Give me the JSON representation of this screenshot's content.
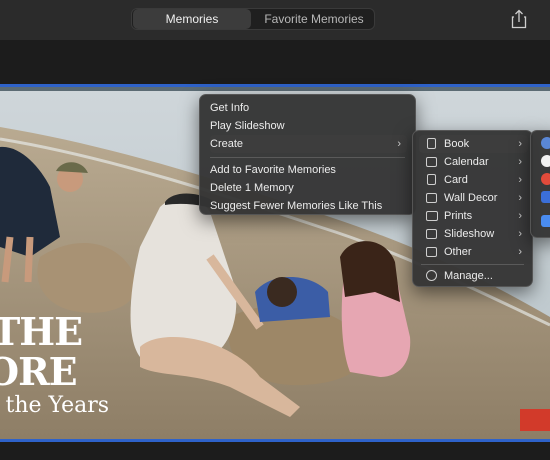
{
  "toolbar": {
    "tabs": [
      {
        "label": "Memories",
        "active": true
      },
      {
        "label": "Favorite Memories",
        "active": false
      }
    ],
    "share_icon": "share-icon"
  },
  "photo": {
    "title_lines": [
      "THE",
      "ORE",
      "r the Years"
    ]
  },
  "context_menu": {
    "items": [
      {
        "label": "Get Info"
      },
      {
        "label": "Play Slideshow"
      },
      {
        "label": "Create",
        "submenu": true
      },
      {
        "label": "Add to Favorite Memories"
      },
      {
        "label": "Delete 1 Memory"
      },
      {
        "label": "Suggest Fewer Memories Like This"
      }
    ]
  },
  "create_submenu": {
    "items": [
      {
        "label": "Book",
        "icon": "book-icon",
        "submenu": true
      },
      {
        "label": "Calendar",
        "icon": "calendar-icon",
        "submenu": true
      },
      {
        "label": "Card",
        "icon": "card-icon",
        "submenu": true
      },
      {
        "label": "Wall Decor",
        "icon": "wall-decor-icon",
        "submenu": true
      },
      {
        "label": "Prints",
        "icon": "prints-icon",
        "submenu": true
      },
      {
        "label": "Slideshow",
        "icon": "slideshow-icon",
        "submenu": true
      },
      {
        "label": "Other",
        "icon": "other-icon",
        "submenu": true
      },
      {
        "label": "Manage...",
        "icon": "more-icon",
        "submenu": false
      }
    ]
  },
  "book_apps_submenu": {
    "icons": [
      "app-icon-1",
      "app-icon-2",
      "app-icon-3",
      "app-icon-4",
      "app-icon-5"
    ],
    "colors": [
      "#5a87d6",
      "#f2f2f2",
      "#e24b3b",
      "#3b6fd8",
      "#4a8cf0"
    ]
  }
}
